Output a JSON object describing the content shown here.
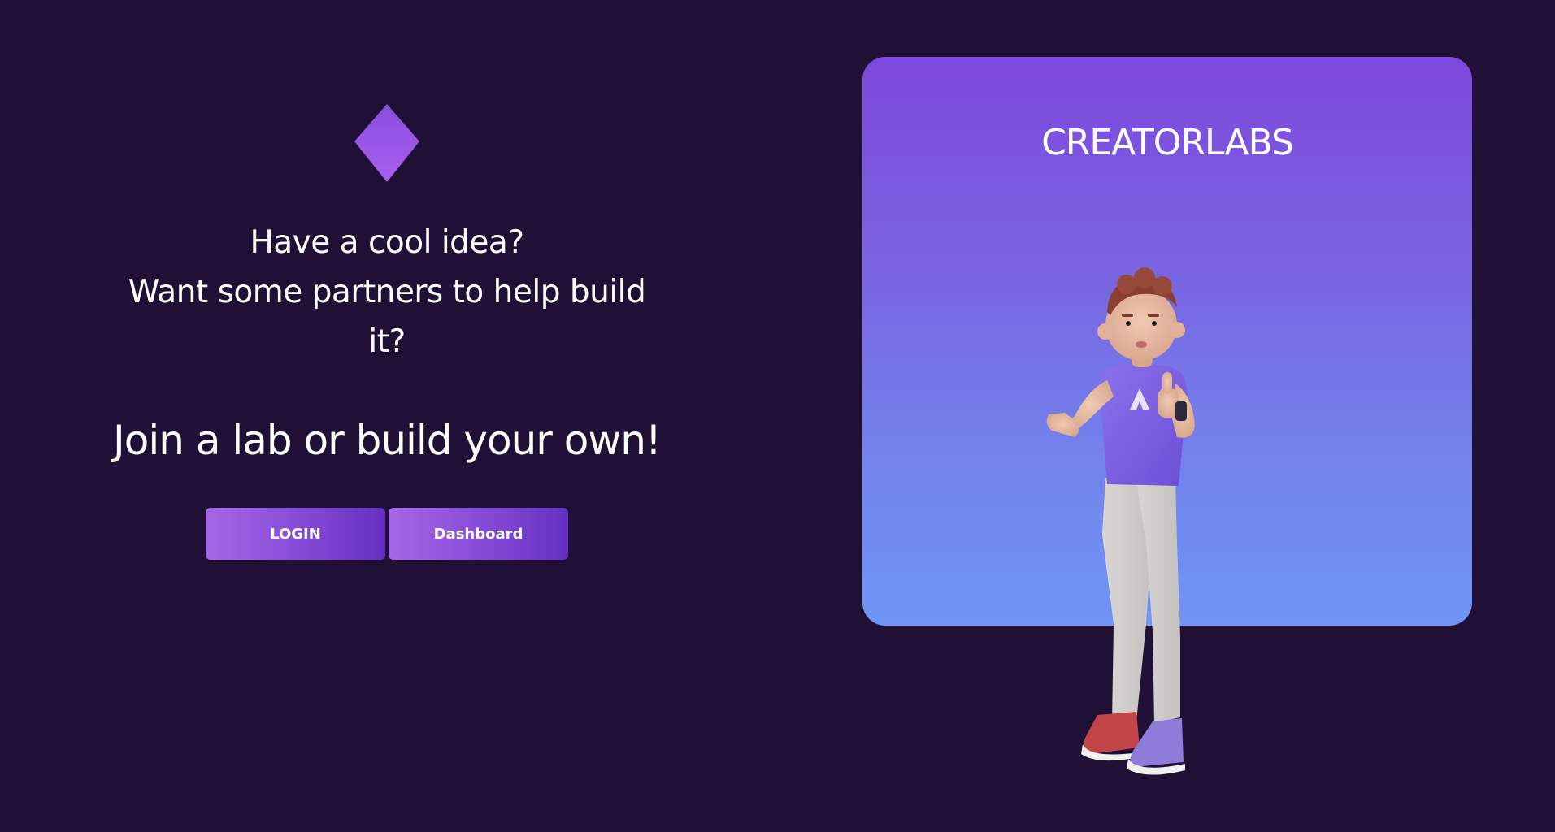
{
  "hero": {
    "question": "Have a cool idea?\nWant some partners to help build it?",
    "question_line1": "Have a cool idea?",
    "question_line2": "Want some partners to help build",
    "question_line3": "it?",
    "cta_title": "Join a lab or build your own!"
  },
  "buttons": {
    "login_label": "LOGIN",
    "dashboard_label": "Dashboard"
  },
  "card": {
    "brand": "CREATORLABS",
    "illustration": "3d-character-thumbs-up",
    "shirt_logo": "A"
  },
  "colors": {
    "background": "#201035",
    "accent": "#8b4fd9",
    "card_top": "#7d48dc",
    "card_bottom": "#6f95f5"
  },
  "icons": {
    "logo": "diamond-icon"
  }
}
